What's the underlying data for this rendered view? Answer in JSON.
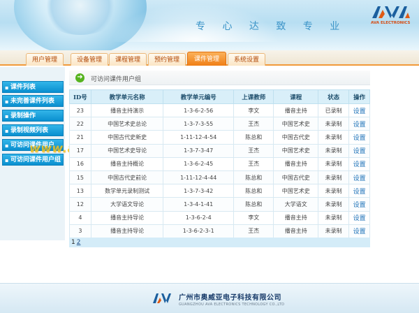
{
  "header": {
    "slogan": "专 心 达 致 专 业",
    "logo_text": "AVA ELECTRONICS",
    "colors": {
      "logo_blue": "#1b5f9e",
      "logo_orange": "#e05a14"
    }
  },
  "nav": {
    "tabs": [
      {
        "label": "用户管理"
      },
      {
        "label": "设备管理"
      },
      {
        "label": "课程管理"
      },
      {
        "label": "预约管理"
      },
      {
        "label": "课件管理",
        "active": true
      },
      {
        "label": "系统设置"
      }
    ]
  },
  "sidebar": {
    "items": [
      {
        "label": "课件列表"
      },
      {
        "label": "未完善课件列表"
      },
      {
        "label": "录制操作"
      },
      {
        "label": "录制视频列表"
      },
      {
        "label": "可访问课件用户"
      },
      {
        "label": "可访问课件用户组"
      }
    ]
  },
  "watermark": "www.ava.com.cn",
  "breadcrumb": {
    "icon": "arrow-right-icon",
    "text": "可访问课件用户组"
  },
  "table": {
    "headers": [
      "ID号",
      "教学单元名称",
      "教学单元编号",
      "上课教师",
      "课程",
      "状态",
      "操作"
    ],
    "rows": [
      [
        "23",
        "播音主持演示",
        "1-3-6-2-56",
        "李文",
        "播音主持",
        "已录制",
        "设置"
      ],
      [
        "22",
        "中国艺术史总论",
        "1-3-7-3-55",
        "王杰",
        "中国艺术史",
        "未录制",
        "设置"
      ],
      [
        "21",
        "中国古代史新史",
        "1-11-12-4-54",
        "陈总和",
        "中国古代史",
        "未录制",
        "设置"
      ],
      [
        "17",
        "中国艺术史导论",
        "1-3-7-3-47",
        "王杰",
        "中国艺术史",
        "未录制",
        "设置"
      ],
      [
        "16",
        "播音主持概论",
        "1-3-6-2-45",
        "王杰",
        "播音主持",
        "未录制",
        "设置"
      ],
      [
        "15",
        "中国古代史前论",
        "1-11-12-4-44",
        "陈总和",
        "中国古代史",
        "未录制",
        "设置"
      ],
      [
        "13",
        "数学单元录制测试",
        "1-3-7-3-42",
        "陈总和",
        "中国艺术史",
        "未录制",
        "设置"
      ],
      [
        "12",
        "大学语文导论",
        "1-3-4-1-41",
        "陈总和",
        "大学语文",
        "未录制",
        "设置"
      ],
      [
        "4",
        "播音主持导论",
        "1-3-6-2-4",
        "李文",
        "播音主持",
        "未录制",
        "设置"
      ],
      [
        "3",
        "播音主持导论",
        "1-3-6-2-3-1",
        "王杰",
        "播音主持",
        "未录制",
        "设置"
      ]
    ]
  },
  "pager": {
    "pages": [
      "1",
      "2"
    ],
    "current": "2"
  },
  "footer": {
    "company": "广州市奥威亚电子科技有限公司",
    "company_en": "GUANGZHOU AVA ELECTRONICS TECHNOLOGY CO.,LTD"
  }
}
